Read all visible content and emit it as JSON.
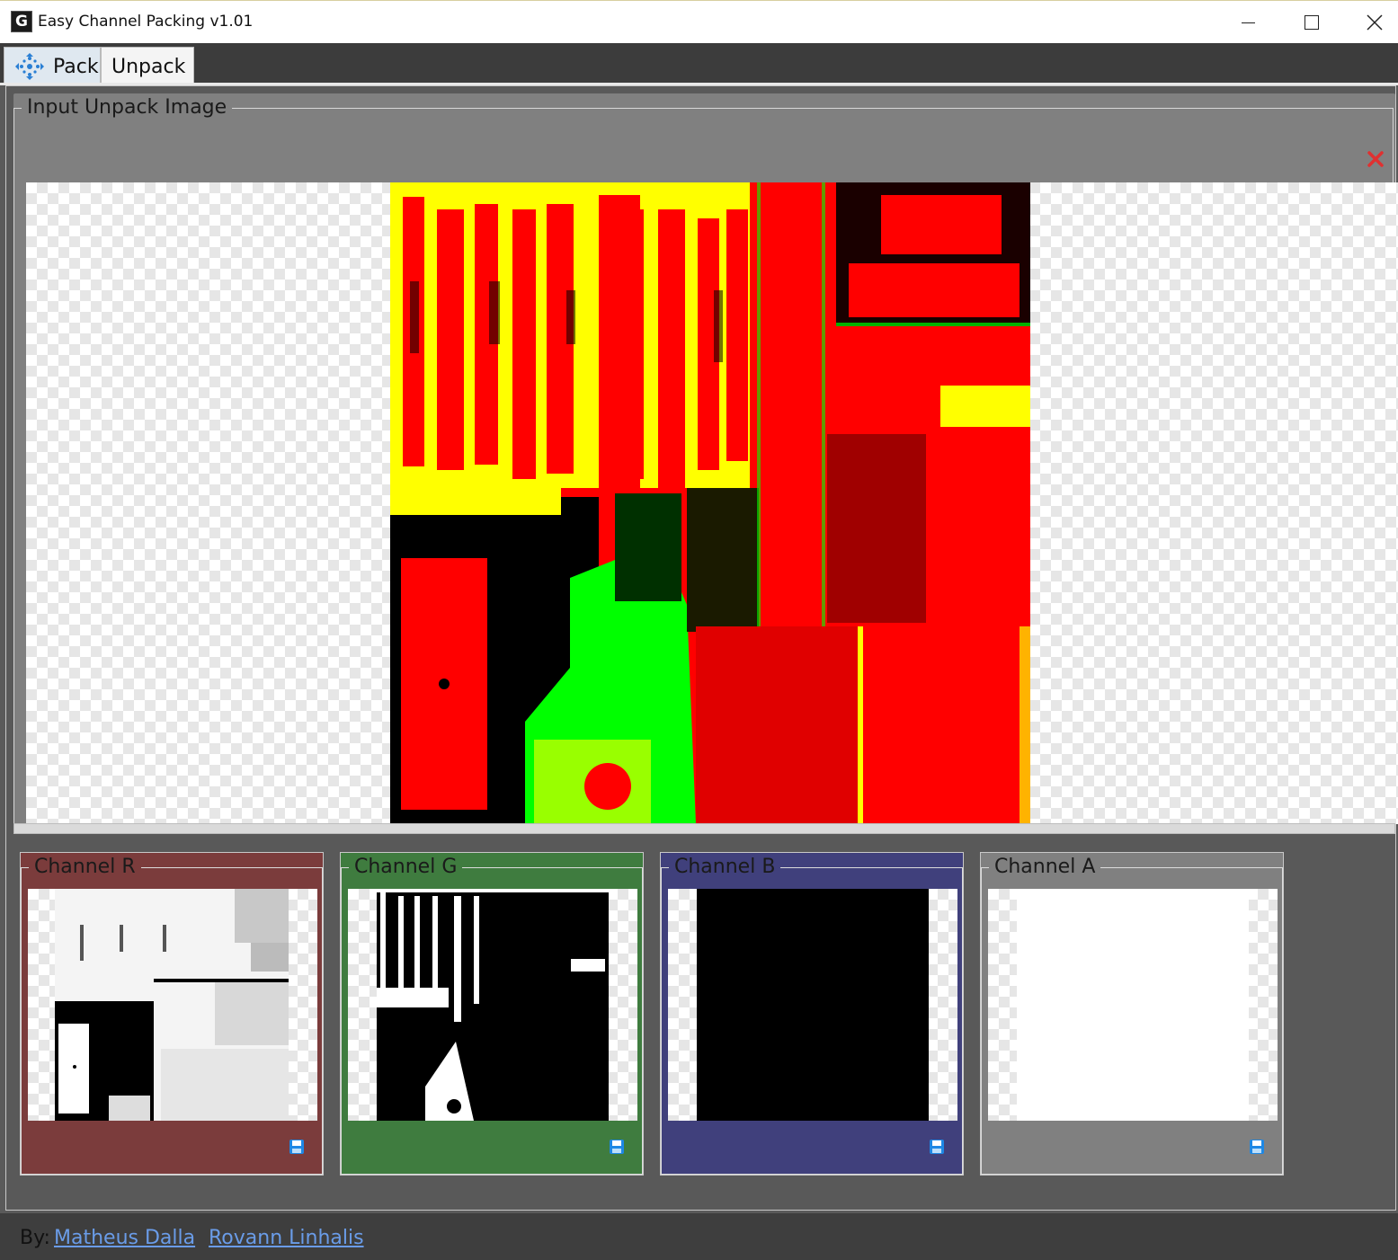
{
  "window": {
    "title": "Easy Channel Packing v1.01",
    "app_icon_glyph": "G"
  },
  "tabs": [
    {
      "label": "Pack",
      "icon": "move-arrows-icon"
    },
    {
      "label": "Unpack"
    }
  ],
  "input_panel": {
    "legend": "Input Unpack Image"
  },
  "channels": [
    {
      "legend": "Channel R",
      "color": "#7b3c3c"
    },
    {
      "legend": "Channel G",
      "color": "#3f7c3f"
    },
    {
      "legend": "Channel B",
      "color": "#40407c"
    },
    {
      "legend": "Channel A",
      "color": "#808080"
    }
  ],
  "footer": {
    "by_label": "By:",
    "author1": "Matheus Dalla",
    "author2": "Rovann Linhalis"
  },
  "colors": {
    "link": "#6a9ce8",
    "remove": "#e03030",
    "save_icon": "#1e88e5"
  }
}
